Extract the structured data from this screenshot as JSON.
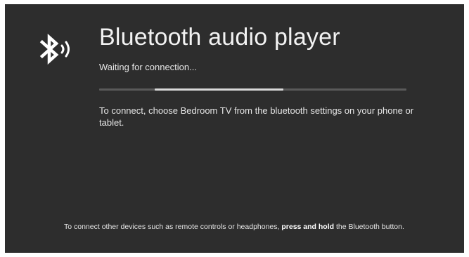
{
  "app": {
    "title": "Bluetooth audio player",
    "status": "Waiting for connection...",
    "icon": "bluetooth-audio-icon"
  },
  "progress": {
    "indeterminate": true,
    "segment_start": 0.18,
    "segment_end": 0.6
  },
  "instructions": {
    "text": "To connect, choose Bedroom TV from the bluetooth settings on your phone or tablet."
  },
  "footer": {
    "text_before": "To connect other devices such as remote controls or headphones, ",
    "bold": "press and hold",
    "text_after": " the Bluetooth button."
  },
  "colors": {
    "background": "#2d2d2d",
    "text": "#e6e6e6",
    "track": "#5a5a5a",
    "fill": "#d9d9d9"
  }
}
